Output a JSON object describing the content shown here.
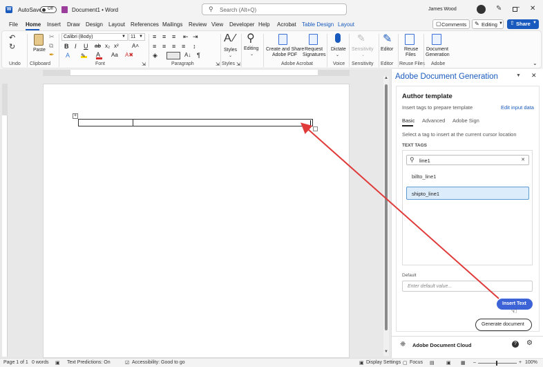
{
  "titlebar": {
    "autosave": "AutoSave",
    "toggle": "Off",
    "doc_title": "Document1  •  Word",
    "search_placeholder": "Search (Alt+Q)",
    "user": "James Wood"
  },
  "menu": {
    "tabs": [
      "File",
      "Home",
      "Insert",
      "Draw",
      "Design",
      "Layout",
      "References",
      "Mailings",
      "Review",
      "View",
      "Developer",
      "Help",
      "Acrobat",
      "Table Design",
      "Layout"
    ],
    "comments": "Comments",
    "editing": "Editing",
    "share": "Share"
  },
  "ribbon": {
    "undo": "Undo",
    "clipboard": "Clipboard",
    "paste": "Paste",
    "font": "Font",
    "font_name": "Calibri (Body)",
    "font_size": "11",
    "paragraph": "Paragraph",
    "styles_group": "Styles",
    "styles": "Styles",
    "editing": "Editing",
    "create_share_l1": "Create and Share",
    "create_share_l2": "Adobe PDF",
    "request_l1": "Request",
    "request_l2": "Signatures",
    "adobe_acrobat": "Adobe Acrobat",
    "dictate": "Dictate",
    "voice": "Voice",
    "sensitivity": "Sensitivity",
    "sensitivity_group": "Sensitivity",
    "editor": "Editor",
    "editor_group": "Editor",
    "reuse_l1": "Reuse",
    "reuse_l2": "Files",
    "reuse_group": "Reuse Files",
    "docgen_l1": "Document",
    "docgen_l2": "Generation",
    "adobe_group": "Adobe"
  },
  "panel": {
    "title": "Adobe Document Generation",
    "section": "Author template",
    "subtitle": "Insert tags to prepare template",
    "edit_link": "Edit input data",
    "tabs": [
      "Basic",
      "Advanced",
      "Adobe Sign"
    ],
    "instruction": "Select a tag to insert at the current cursor location",
    "text_tags_label": "TEXT TAGS",
    "search_value": "line1",
    "tags": [
      "billto_line1",
      "shipto_line1"
    ],
    "default_label": "Default",
    "default_placeholder": "Enter default value...",
    "insert_button": "Insert Text",
    "generate_button": "Generate document",
    "footer": "Adobe Document Cloud"
  },
  "status": {
    "page": "Page 1 of 1",
    "words": "0 words",
    "predictions": "Text Predictions: On",
    "accessibility": "Accessibility: Good to go",
    "display": "Display Settings",
    "focus": "Focus",
    "zoom": "100%"
  },
  "colors": {
    "word_blue": "#185abd",
    "adobe_blue": "#3c64d6",
    "annotation_red": "#e03a3a"
  }
}
